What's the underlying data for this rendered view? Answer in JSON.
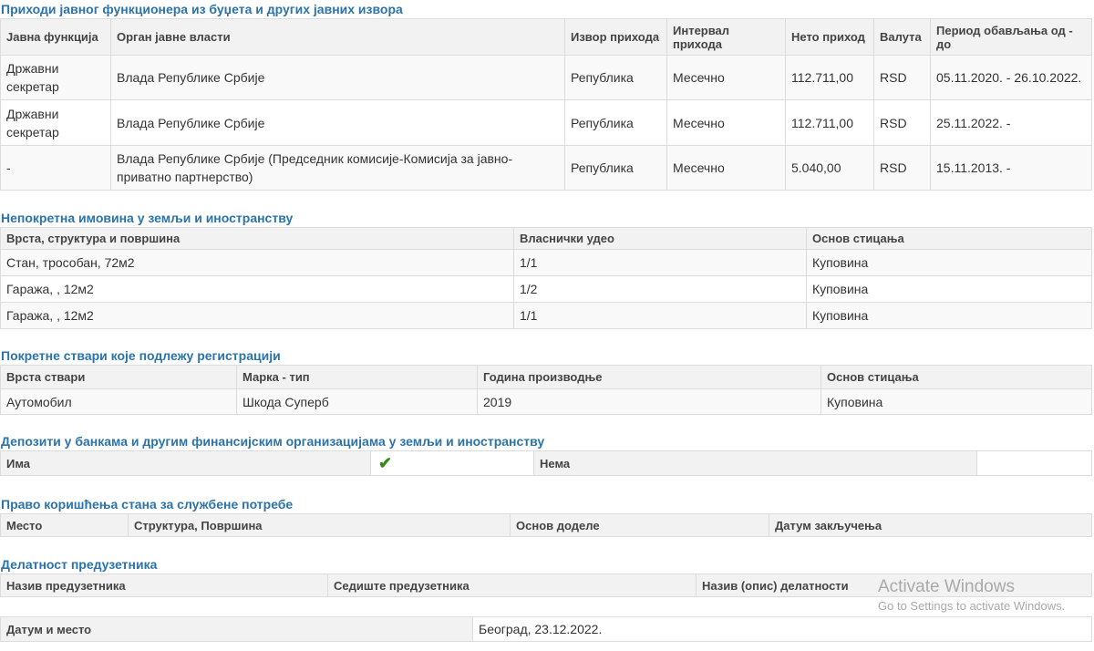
{
  "income": {
    "title": "Приходи јавног функционера из буџета и других јавних извора",
    "headers": [
      "Јавна функција",
      "Орган јавне власти",
      "Извор прихода",
      "Интервал прихода",
      "Нето приход",
      "Валута",
      "Период обављања од - до"
    ],
    "rows": [
      [
        "Државни секретар",
        "Влада Републике Србије",
        "Република",
        "Месечно",
        "112.711,00",
        "RSD",
        "05.11.2020. - 26.10.2022."
      ],
      [
        "Државни секретар",
        "Влада Републике Србије",
        "Република",
        "Месечно",
        "112.711,00",
        "RSD",
        "25.11.2022. -"
      ],
      [
        "-",
        "Влада Републике Србије (Председник комисије-Комисија за јавно-приватно партнерство)",
        "Република",
        "Месечно",
        "5.040,00",
        "RSD",
        "15.11.2013. -"
      ]
    ]
  },
  "realestate": {
    "title": "Непокретна имовина у земљи и иностранству",
    "headers": [
      "Врста, структура и површина",
      "Власнички удео",
      "Основ стицања"
    ],
    "rows": [
      [
        "Стан, трособан, 72м2",
        "1/1",
        "Куповина"
      ],
      [
        "Гаража, , 12м2",
        "1/2",
        "Куповина"
      ],
      [
        "Гаража, , 12м2",
        "1/1",
        "Куповина"
      ]
    ]
  },
  "vehicles": {
    "title": "Покретне ствари које подлежу регистрацији",
    "headers": [
      "Врста ствари",
      "Марка - тип",
      "Година производње",
      "Основ стицања"
    ],
    "rows": [
      [
        "Аутомобил",
        "Шкода Суперб",
        "2019",
        "Куповина"
      ]
    ]
  },
  "deposits": {
    "title": "Депозити у банкама и другим финансијским организацијама у земљи и иностранству",
    "has_label": "Има",
    "has_checked": true,
    "check_icon": "check-icon",
    "none_label": "Нема"
  },
  "apartment": {
    "title": "Право коришћења стана за службене потребе",
    "headers": [
      "Место",
      "Структура, Површина",
      "Основ доделе",
      "Датум закључења"
    ]
  },
  "entrepreneur": {
    "title": "Делатност предузетника",
    "headers": [
      "Назив предузетника",
      "Седиште предузетника",
      "Назив (опис) делатности"
    ]
  },
  "footer": {
    "label": "Датум и место",
    "value": "Београд, 23.12.2022."
  },
  "watermark": {
    "title": "Activate Windows",
    "subtitle": "Go to Settings to activate Windows."
  }
}
